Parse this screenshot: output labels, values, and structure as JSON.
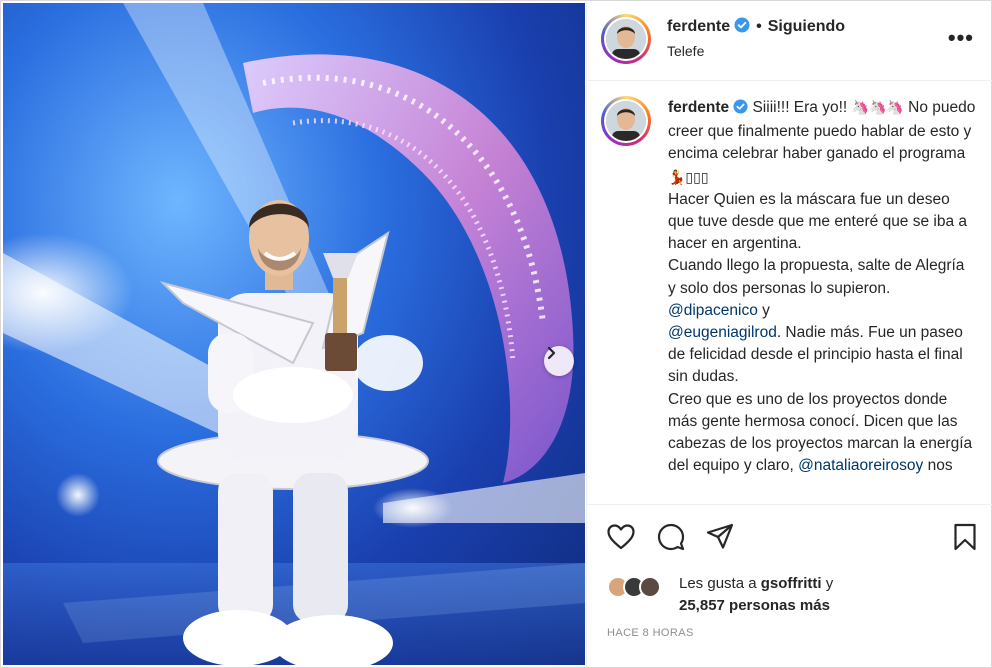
{
  "header": {
    "username": "ferdente",
    "separator": "•",
    "follow_status": "Siguiendo",
    "location": "Telefe",
    "more_label": "•••"
  },
  "caption": {
    "username": "ferdente",
    "first_line": "Siiii!!! Era yo!!",
    "emoji_after_first_line": "🦄🦄🦄",
    "line_2": "No puedo creer que finalmente puedo hablar de esto y encima celebrar haber ganado el programa",
    "emoji_after_line_2": "💃▯▯▯",
    "line_3": "Hacer Quien es la máscara fue un deseo que tuve desde que me enteré que se iba a hacer en argentina.",
    "line_4": "Cuando llego la propuesta, salte de Alegría y solo dos personas lo supieron.",
    "mention_1": "@dipacenico",
    "conj_1": "y",
    "mention_2": "@eugeniagilrod",
    "line_5": ". Nadie más. Fue un paseo de felicidad desde el principio hasta el final sin dudas.",
    "line_6": "Creo que es uno de los proyectos donde más gente hermosa conocí. Dicen que las cabezas de los proyectos marcan la energía del equipo y claro,",
    "mention_3": "@nataliaoreirosoy",
    "tail": "nos"
  },
  "likes": {
    "prefix": "Les gusta a",
    "liker": "gsoffritti",
    "conj": "y",
    "count_text": "25,857 personas más"
  },
  "timestamp": "HACE 8 HORAS",
  "icons": [
    "heart-icon",
    "comment-icon",
    "share-icon",
    "save-icon",
    "verified-badge-icon",
    "chevron-right-icon"
  ],
  "colors": {
    "verified": "#3897f0",
    "mention": "#00376b",
    "muted": "#8e8e8e",
    "stage_blue": "#2b6fe0"
  }
}
